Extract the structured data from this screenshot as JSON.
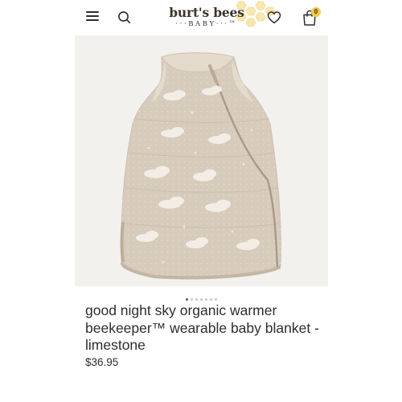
{
  "header": {
    "logo_main": "burt's bees",
    "logo_sub": "···BABY···™",
    "cart_count": "0",
    "icons": {
      "menu": "hamburger-menu-icon",
      "search": "search-icon",
      "wishlist": "heart-icon",
      "cart": "shopping-bag-icon"
    }
  },
  "gallery": {
    "image_alt": "good night sky organic warmer beekeeper wearable baby blanket - limestone",
    "total_images": 7,
    "active_index": 0
  },
  "product": {
    "title": "good night sky organic warmer beekeeper™ wearable baby blanket - limestone",
    "price": "$36.95"
  },
  "colors": {
    "fabric": "#d7cbbc",
    "trim": "#e4dbcc",
    "text": "#2d2d2d",
    "honey": "#f4c84a"
  }
}
